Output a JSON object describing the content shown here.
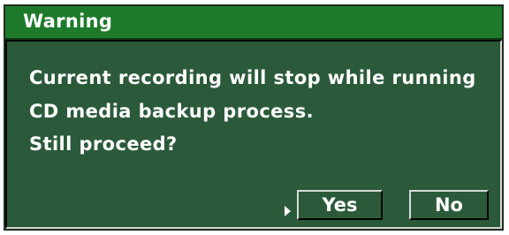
{
  "dialog": {
    "title": "Warning",
    "message": {
      "line1": "Current recording will stop while running",
      "line2": "CD media backup process.",
      "line3": "Still proceed?"
    },
    "buttons": {
      "yes_label": "Yes",
      "no_label": "No"
    },
    "focus_indicator_icon": "triangle-right-icon",
    "colors": {
      "title_bar": "#1d7a2a",
      "body": "#2b5a3a",
      "text": "#ffffff"
    }
  }
}
